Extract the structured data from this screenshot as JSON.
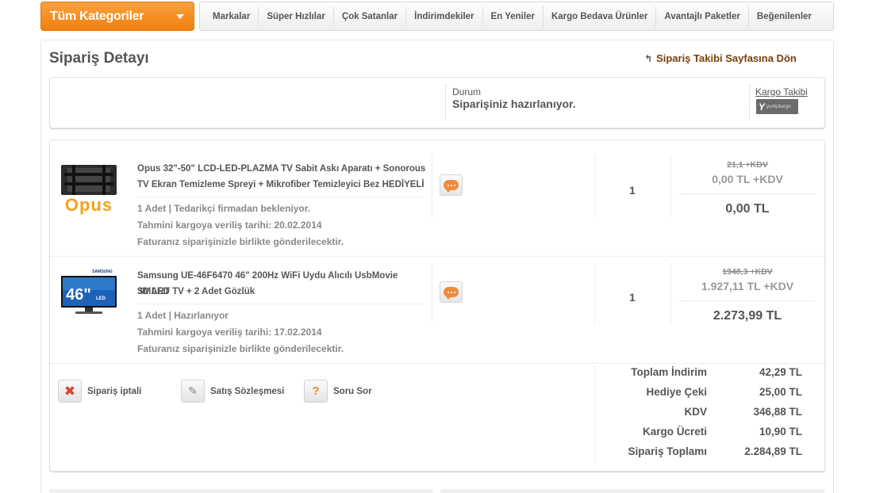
{
  "top_nav": {
    "category_button": "Tüm Kategoriler",
    "items": [
      "Markalar",
      "Süper Hızlılar",
      "Çok Satanlar",
      "İndirimdekiler",
      "En Yeniler",
      "Kargo Bedava Ürünler",
      "Avantajlı Paketler",
      "Beğenilenler"
    ]
  },
  "page": {
    "title": "Sipariş Detayı",
    "back_link": "Sipariş Takibi Sayfasına Dön"
  },
  "status": {
    "label": "Durum",
    "value": "Siparişiniz hazırlanıyor.",
    "cargo_label": "Kargo Takibi",
    "cargo_logo_text": "yurtiçikargo"
  },
  "products": [
    {
      "brand_logo": "Opus",
      "title_line1": "Opus 32\"-50\" LCD-LED-PLAZMA TV Sabit Askı Aparatı + Sonorous",
      "title_line2": "TV Ekran Temizleme Spreyi + Mikrofiber Temizleyici Bez HEDİYELİ",
      "info": "1 Adet | Tedarikçi firmadan bekleniyor.",
      "shipping_date": "Tahmini kargoya veriliş tarihi: 20.02.2014",
      "invoice_note": "Faturanız siparişinizle birlikte gönderilecektir.",
      "quantity": "1",
      "old_price": "21,1 +KDV",
      "unit_price": "0,00 TL +KDV",
      "total_price": "0,00 TL"
    },
    {
      "brand_logo": "SAMSUNG",
      "screen_size": "46\"",
      "screen_tag": "LED",
      "title_line1": "Samsung UE-46F6470 46\" 200Hz WiFi Uydu Alıcılı UsbMovie SMART",
      "title_line2": "3D LED TV + 2 Adet Gözlük",
      "info": "1 Adet | Hazırlanıyor",
      "shipping_date": "Tahmini kargoya veriliş tarihi: 17.02.2014",
      "invoice_note": "Faturanız siparişinizle birlikte gönderilecektir.",
      "quantity": "1",
      "old_price": "1948,3 +KDV",
      "unit_price": "1.927,11 TL +KDV",
      "total_price": "2.273,99 TL"
    }
  ],
  "actions": {
    "cancel": "Sipariş iptali",
    "contract": "Satış Sözleşmesi",
    "question": "Soru Sor"
  },
  "summary": [
    {
      "label": "Toplam İndirim",
      "value": "42,29 TL"
    },
    {
      "label": "Hediye Çeki",
      "value": "25,00 TL"
    },
    {
      "label": "KDV",
      "value": "346,88 TL"
    },
    {
      "label": "Kargo Ücreti",
      "value": "10,90 TL"
    },
    {
      "label": "Sipariş Toplamı",
      "value": "2.284,89 TL"
    }
  ],
  "colors": {
    "accent_orange": "#f08a1c",
    "link_brown": "#7a3e0a",
    "text_gray": "#555555"
  }
}
